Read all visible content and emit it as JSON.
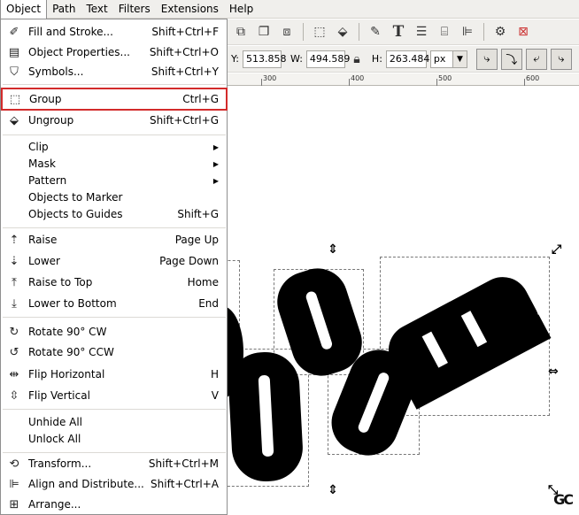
{
  "menubar": [
    "Object",
    "Path",
    "Text",
    "Filters",
    "Extensions",
    "Help"
  ],
  "menu": {
    "items": [
      {
        "label": "Fill and Stroke...",
        "accel": "Shift+Ctrl+F",
        "icon": "fill-stroke-icon"
      },
      {
        "label": "Object Properties...",
        "accel": "Shift+Ctrl+O",
        "icon": "object-properties-icon"
      },
      {
        "label": "Symbols...",
        "accel": "Shift+Ctrl+Y",
        "icon": "symbols-icon"
      },
      {
        "label": "Group",
        "accel": "Ctrl+G",
        "icon": "group-icon"
      },
      {
        "label": "Ungroup",
        "accel": "Shift+Ctrl+G",
        "icon": "ungroup-icon"
      },
      {
        "label": "Clip",
        "accel": "",
        "submenu": true
      },
      {
        "label": "Mask",
        "accel": "",
        "submenu": true
      },
      {
        "label": "Pattern",
        "accel": "",
        "submenu": true
      },
      {
        "label": "Objects to Marker",
        "accel": ""
      },
      {
        "label": "Objects to Guides",
        "accel": "Shift+G"
      },
      {
        "label": "Raise",
        "accel": "Page Up",
        "icon": "raise-icon"
      },
      {
        "label": "Lower",
        "accel": "Page Down",
        "icon": "lower-icon"
      },
      {
        "label": "Raise to Top",
        "accel": "Home",
        "icon": "raise-to-top-icon"
      },
      {
        "label": "Lower to Bottom",
        "accel": "End",
        "icon": "lower-to-bottom-icon"
      },
      {
        "label": "Rotate 90° CW",
        "accel": "",
        "icon": "rotate-cw-icon"
      },
      {
        "label": "Rotate 90° CCW",
        "accel": "",
        "icon": "rotate-ccw-icon"
      },
      {
        "label": "Flip Horizontal",
        "accel": "H",
        "icon": "flip-horizontal-icon"
      },
      {
        "label": "Flip Vertical",
        "accel": "V",
        "icon": "flip-vertical-icon"
      },
      {
        "label": "Unhide All",
        "accel": ""
      },
      {
        "label": "Unlock All",
        "accel": ""
      },
      {
        "label": "Transform...",
        "accel": "Shift+Ctrl+M",
        "icon": "transform-icon"
      },
      {
        "label": "Align and Distribute...",
        "accel": "Shift+Ctrl+A",
        "icon": "align-icon"
      },
      {
        "label": "Arrange...",
        "accel": "",
        "icon": "arrange-icon"
      }
    ]
  },
  "toolbar": {
    "y_label": "Y:",
    "y_value": "513.858",
    "w_label": "W:",
    "w_value": "494.589",
    "h_label": "H:",
    "h_value": "263.484",
    "unit": "px"
  },
  "ruler": [
    "300",
    "400",
    "500",
    "600"
  ],
  "watermark": "GC"
}
